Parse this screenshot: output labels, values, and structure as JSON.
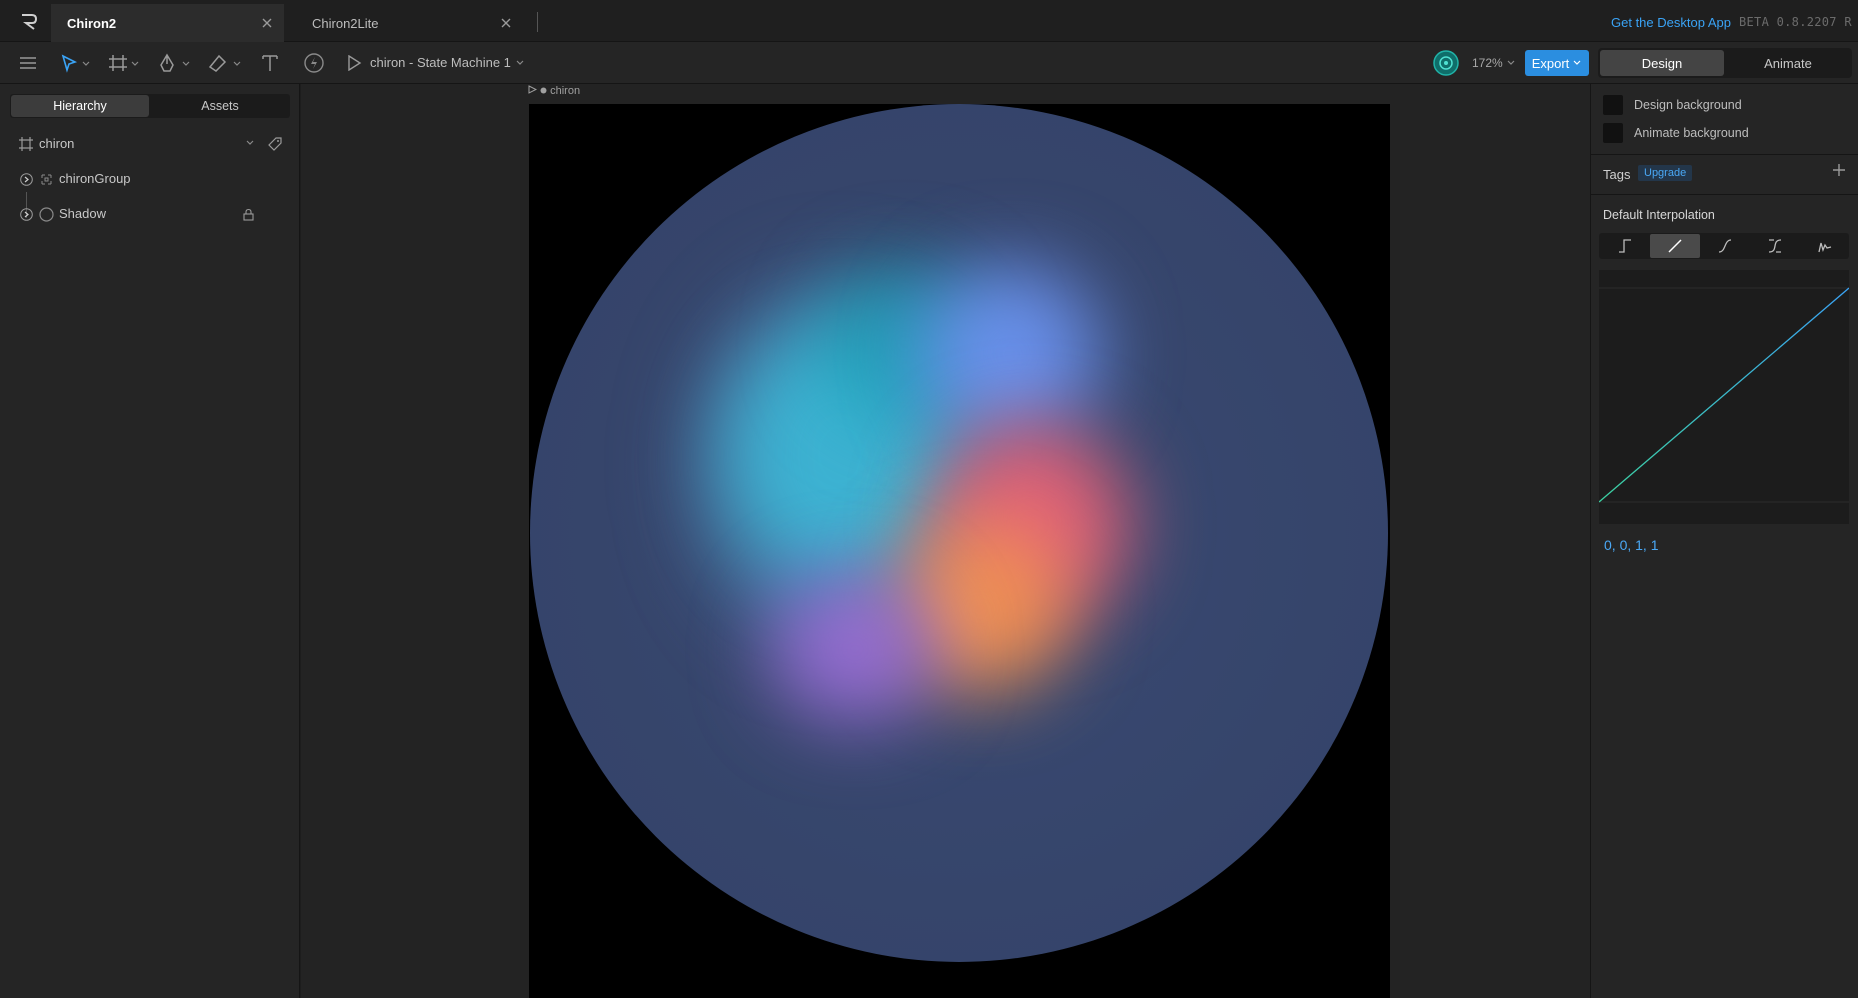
{
  "tabs": [
    {
      "label": "Chiron2",
      "active": true
    },
    {
      "label": "Chiron2Lite",
      "active": false
    }
  ],
  "header": {
    "desktop_link": "Get the Desktop App",
    "version": "BETA 0.8.2207 R"
  },
  "toolbar": {
    "state_machine_label": "chiron - State Machine 1",
    "zoom": "172%",
    "export_label": "Export",
    "mode_design": "Design",
    "mode_animate": "Animate",
    "active_mode": "Design"
  },
  "left_panel": {
    "tabs": [
      "Hierarchy",
      "Assets"
    ],
    "active_tab": "Hierarchy",
    "artboard": "chiron",
    "items": [
      {
        "label": "chironGroup",
        "locked": false
      },
      {
        "label": "Shadow",
        "locked": true
      }
    ]
  },
  "canvas": {
    "artboard_label": "chiron"
  },
  "right_panel": {
    "design_background": "Design background",
    "animate_background": "Animate background",
    "tags_title": "Tags",
    "upgrade_label": "Upgrade",
    "interpolation_title": "Default Interpolation",
    "interpolation_selected": "linear",
    "curve_values": "0, 0, 1, 1"
  },
  "colors": {
    "accent": "#2b8ee0",
    "link": "#3aa3f5",
    "curve": "#4aa8f5",
    "orb_base": "#36456b"
  }
}
